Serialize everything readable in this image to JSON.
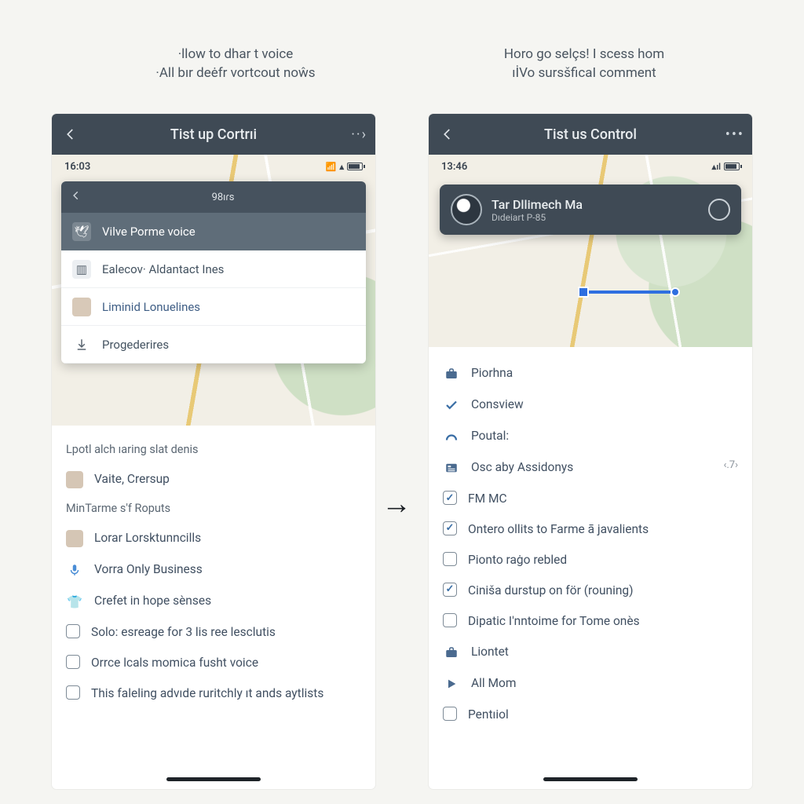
{
  "captions": {
    "left_line1": "·llow to dhar t voice",
    "left_line2": "·All bır deėfr vortcout noŵs",
    "right_line1": "Horo go selçs! I scess hom",
    "right_line2": "ıİVo sursšficaI comment"
  },
  "left": {
    "outer_title": "Tist up Cortrıi",
    "status_time": "16:03",
    "drop_header": "98ıɾs",
    "drop_items": [
      {
        "label": "Vilve Porme voice",
        "style": "sel"
      },
      {
        "label": "Ealecov· Aldantact Ines",
        "style": "norm"
      },
      {
        "label": "Liminid Lonuelines",
        "style": "alt"
      },
      {
        "label": "Progederires",
        "style": "plain"
      }
    ],
    "section1": "Lpotl alch ıaring slat denis",
    "row_vaite": "Vaite, Crersup",
    "section2": "MinTarme s'f Roputs",
    "row_lorar": "Lorar Lorsktunncills",
    "row_vorra": "Vorra Only Business",
    "row_crefet": "Crefet in hope sènses",
    "checks": [
      {
        "label": "Solo: esreage for 3 lis ree lesclutis",
        "checked": false
      },
      {
        "label": "Orrce lcals momica fusht voice",
        "checked": false
      },
      {
        "label": "This faleling advıde ruritchly ıt ands aytlists",
        "checked": false
      }
    ]
  },
  "right": {
    "outer_title": "Tist us Control",
    "status_time": "13:46",
    "banner_title": "Tar Dllimech Ma",
    "banner_sub": "Dıdeiart P-85",
    "items": [
      {
        "icon": "briefcase",
        "label": "Piorhna",
        "checked": null
      },
      {
        "icon": "check",
        "label": "Consview",
        "checked": null
      },
      {
        "icon": "arc",
        "label": "Poutal:",
        "checked": null
      },
      {
        "icon": "news",
        "label": "Osc aby Assidonys",
        "checked": null,
        "tail": "‹.7›"
      },
      {
        "icon": "box",
        "label": "FM MC",
        "checked": true
      },
      {
        "icon": "box",
        "label": "Ontero ollits to Farme ā javalients",
        "checked": true
      },
      {
        "icon": "box",
        "label": "Pionto raġo rebled",
        "checked": false
      },
      {
        "icon": "box",
        "label": "Ciniša durstup on för (rouning)",
        "checked": true
      },
      {
        "icon": "box",
        "label": "Dipatic I'nntoime for Tome onès",
        "checked": false
      },
      {
        "icon": "briefcase",
        "label": "Liontet",
        "checked": null
      },
      {
        "icon": "play",
        "label": "All Mom",
        "checked": null
      },
      {
        "icon": "box",
        "label": "Pentıiol",
        "checked": false
      }
    ]
  }
}
